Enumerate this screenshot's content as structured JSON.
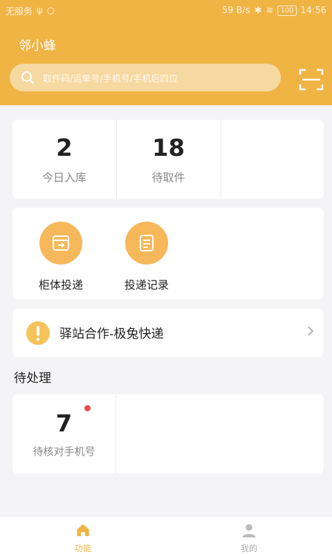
{
  "status_bar": {
    "carrier": "无服务",
    "speed": "59 B/s",
    "battery": "100",
    "time": "14:56"
  },
  "header": {
    "app_title": "邻小蜂",
    "search_placeholder": "取件码/运单号/手机号/手机后四位"
  },
  "stats": [
    {
      "value": "2",
      "label": "今日入库"
    },
    {
      "value": "18",
      "label": "待取件"
    }
  ],
  "actions": [
    {
      "label": "柜体投递",
      "icon": "cabinet-icon"
    },
    {
      "label": "投递记录",
      "icon": "record-icon"
    }
  ],
  "notice": {
    "text": "驿站合作-极兔快递",
    "icon": "exclamation-icon"
  },
  "pending_section": {
    "title": "待处理",
    "items": [
      {
        "value": "7",
        "label": "待核对手机号",
        "has_dot": true
      }
    ]
  },
  "tab_bar": {
    "tabs": [
      {
        "label": "功能",
        "icon": "home-icon",
        "active": true
      },
      {
        "label": "我的",
        "icon": "person-icon",
        "active": false
      }
    ]
  },
  "colors": {
    "brand": "#f0b445",
    "icon_circle": "#f6b85b",
    "badge_dot": "#e84b4b"
  }
}
